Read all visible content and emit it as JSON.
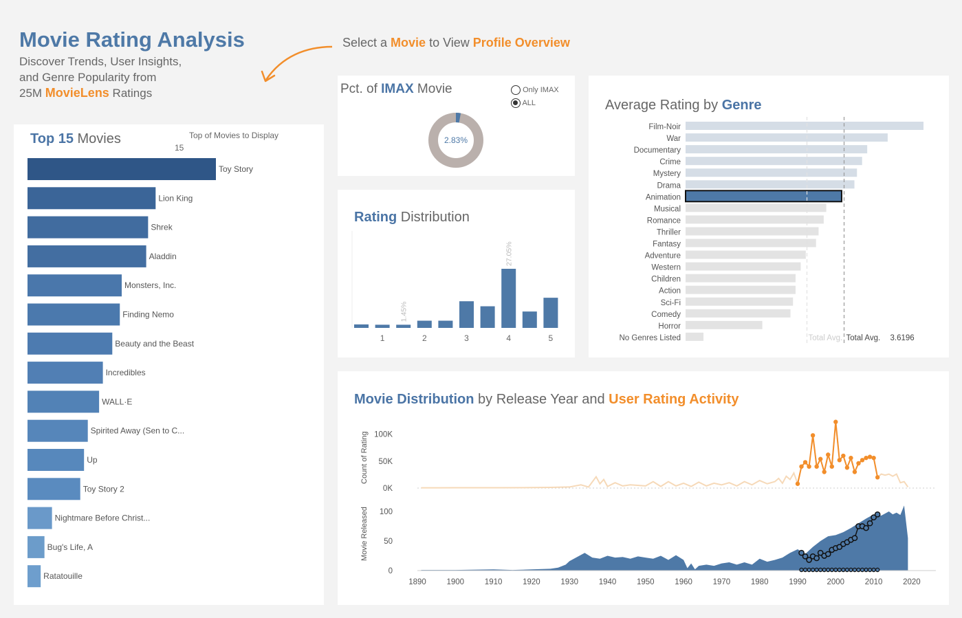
{
  "header": {
    "title": "Movie Rating Analysis",
    "subtitle_line1": "Discover Trends, User Insights,",
    "subtitle_line2": "and Genre Popularity from",
    "subtitle_prefix": "25M ",
    "subtitle_brand": "MovieLens",
    "subtitle_suffix": " Ratings",
    "hint_prefix": "Select a ",
    "hint_movie": "Movie",
    "hint_mid": " to View ",
    "hint_profile": "Profile Overview"
  },
  "top_movies": {
    "title_bold": "Top 15",
    "title_rest": " Movies",
    "param_label": "Top of Movies to Display",
    "param_value": "15"
  },
  "imax": {
    "title_pre": "Pct. of ",
    "title_bold": "IMAX",
    "title_post": " Movie",
    "value_label": "2.83%",
    "options": [
      "Only IMAX",
      "ALL"
    ],
    "selected": "ALL"
  },
  "rating_dist": {
    "title_bold": "Rating",
    "title_rest": " Distribution"
  },
  "genre": {
    "title_pre": "Average Rating by ",
    "title_bold": "Genre"
  },
  "timeline": {
    "title_bold1": "Movie Distribution",
    "title_mid": " by Release Year and ",
    "title_bold2": "User Rating Activity"
  },
  "colors": {
    "blue": "#4e79a7",
    "dark_blue": "#2f5687",
    "orange": "#f28e2b",
    "light_orange": "#f6d9b8",
    "grey_bar": "#e3e3e3",
    "light_blue_bar": "#d5dde6",
    "donut_grey": "#bab0ac"
  },
  "chart_data": [
    {
      "id": "top15",
      "type": "bar",
      "orientation": "horizontal",
      "categories": [
        "Toy Story",
        "Lion King",
        "Shrek",
        "Aladdin",
        "Monsters, Inc.",
        "Finding Nemo",
        "Beauty and the Beast",
        "Incredibles",
        "WALL·E",
        "Spirited Away (Sen to C...",
        "Up",
        "Toy Story 2",
        "Nightmare Before Christ...",
        "Bug's Life, A",
        "Ratatouille"
      ],
      "values": [
        100,
        68,
        64,
        63,
        50,
        49,
        45,
        40,
        38,
        32,
        30,
        28,
        13,
        9,
        7
      ]
    },
    {
      "id": "imax",
      "type": "pie",
      "categories": [
        "IMAX",
        "Non-IMAX"
      ],
      "values": [
        2.83,
        97.17
      ],
      "label": "2.83%"
    },
    {
      "id": "rating_distribution",
      "type": "bar",
      "x": [
        0.5,
        1,
        1.5,
        2,
        2.5,
        3,
        3.5,
        4,
        4.5,
        5
      ],
      "values": [
        1.6,
        1.45,
        1.45,
        3.3,
        3.3,
        12.2,
        9.9,
        27.05,
        7.5,
        13.8
      ],
      "labels": {
        "1.5": "1.45%",
        "4": "27.05%"
      },
      "xticks": [
        "1",
        "2",
        "3",
        "4",
        "5"
      ]
    },
    {
      "id": "genre_avg",
      "type": "bar",
      "orientation": "horizontal",
      "categories": [
        "Film-Noir",
        "War",
        "Documentary",
        "Crime",
        "Mystery",
        "Drama",
        "Animation",
        "Musical",
        "Romance",
        "Thriller",
        "Fantasy",
        "Adventure",
        "Western",
        "Children",
        "Action",
        "Sci-Fi",
        "Comedy",
        "Horror",
        "No Genres Listed"
      ],
      "values": [
        3.93,
        3.79,
        3.71,
        3.69,
        3.67,
        3.66,
        3.61,
        3.55,
        3.54,
        3.52,
        3.51,
        3.47,
        3.45,
        3.43,
        3.43,
        3.42,
        3.41,
        3.3,
        3.07
      ],
      "highlight": "Animation",
      "reference_line": {
        "label": "Total Avg.",
        "value": "3.6196"
      }
    },
    {
      "id": "rating_activity",
      "type": "line",
      "ylabel": "Count of Rating",
      "yticks": [
        "0K",
        "50K",
        "100K"
      ],
      "ylim": [
        0,
        115000
      ],
      "x": [
        1891,
        1900,
        1910,
        1920,
        1925,
        1930,
        1933,
        1935,
        1937,
        1938,
        1939,
        1940,
        1942,
        1944,
        1946,
        1950,
        1952,
        1954,
        1956,
        1958,
        1960,
        1962,
        1964,
        1966,
        1968,
        1970,
        1972,
        1974,
        1976,
        1978,
        1980,
        1982,
        1984,
        1985,
        1986,
        1987,
        1988,
        1989,
        1990,
        1991,
        1992,
        1993,
        1994,
        1995,
        1996,
        1997,
        1998,
        1999,
        2000,
        2001,
        2002,
        2003,
        2004,
        2005,
        2006,
        2007,
        2008,
        2009,
        2010,
        2011,
        2012,
        2013,
        2014,
        2015,
        2016,
        2017,
        2018,
        2019
      ],
      "values": [
        500,
        600,
        700,
        900,
        1200,
        2000,
        6000,
        2000,
        21000,
        8000,
        16000,
        3000,
        10000,
        4000,
        6000,
        4000,
        12000,
        3000,
        12000,
        4000,
        9000,
        3000,
        11000,
        4000,
        9000,
        6000,
        10000,
        4000,
        12000,
        6000,
        14000,
        8000,
        12000,
        18000,
        9000,
        22000,
        16000,
        28000,
        8000,
        40000,
        48000,
        40000,
        98000,
        40000,
        54000,
        30000,
        62000,
        40000,
        123000,
        52000,
        60000,
        38000,
        56000,
        30000,
        46000,
        52000,
        56000,
        58000,
        56000,
        20000,
        26000,
        24000,
        26000,
        22000,
        26000,
        10000,
        12000,
        2000
      ],
      "highlight_range": [
        1990,
        2011
      ]
    },
    {
      "id": "movies_released",
      "type": "area",
      "ylabel": "Movie Released",
      "yticks": [
        "0",
        "50",
        "100"
      ],
      "ylim": [
        0,
        110
      ],
      "xticks": [
        "1890",
        "1900",
        "1910",
        "1920",
        "1930",
        "1940",
        "1950",
        "1960",
        "1970",
        "1980",
        "1990",
        "2000",
        "2010",
        "2020"
      ],
      "x": [
        1891,
        1900,
        1910,
        1915,
        1920,
        1925,
        1927,
        1929,
        1930,
        1932,
        1934,
        1936,
        1938,
        1940,
        1942,
        1944,
        1946,
        1948,
        1950,
        1952,
        1954,
        1956,
        1958,
        1960,
        1961,
        1962,
        1963,
        1964,
        1966,
        1968,
        1970,
        1972,
        1974,
        1976,
        1978,
        1980,
        1982,
        1984,
        1986,
        1988,
        1990,
        1992,
        1994,
        1996,
        1998,
        2000,
        2002,
        2004,
        2006,
        2008,
        2010,
        2012,
        2014,
        2015,
        2016,
        2017,
        2018,
        2019
      ],
      "values": [
        1,
        1,
        2,
        1,
        2,
        3,
        5,
        10,
        16,
        23,
        30,
        22,
        20,
        25,
        22,
        23,
        20,
        24,
        22,
        20,
        25,
        18,
        26,
        18,
        4,
        12,
        2,
        8,
        10,
        8,
        12,
        14,
        10,
        14,
        10,
        20,
        15,
        18,
        22,
        30,
        36,
        28,
        40,
        50,
        58,
        60,
        65,
        72,
        80,
        88,
        95,
        93,
        100,
        95,
        98,
        94,
        110,
        55
      ],
      "markers": {
        "x": [
          1991,
          1992,
          1993,
          1994,
          1995,
          1996,
          1997,
          1998,
          1999,
          2000,
          2001,
          2002,
          2003,
          2004,
          2005,
          2006,
          2007,
          2008,
          2009,
          2010,
          2011
        ],
        "values": [
          30,
          24,
          18,
          24,
          21,
          30,
          25,
          28,
          35,
          38,
          40,
          45,
          48,
          52,
          55,
          75,
          75,
          72,
          80,
          90,
          95
        ]
      }
    }
  ]
}
